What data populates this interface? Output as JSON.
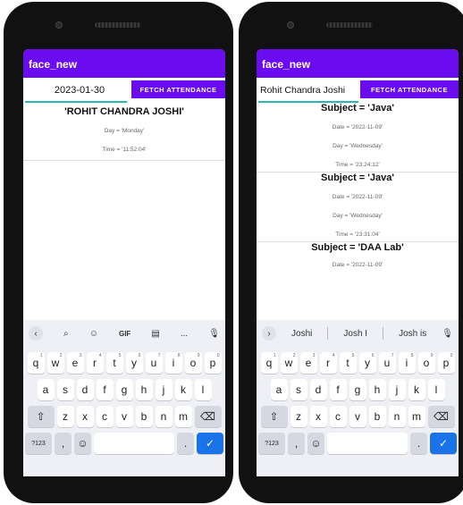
{
  "left": {
    "app_title": "face_new",
    "date_input_value": "2023-01-30",
    "fetch_label": "FETCH ATTENDANCE",
    "name_line": "'ROHIT CHANDRA JOSHI'",
    "day_line": "Day = 'Monday'",
    "time_line": "Time = '11:52:04'",
    "toolbar_gif": "GIF",
    "toolbar_more": "...",
    "key_123": "?123",
    "key_comma": ",",
    "key_period": "."
  },
  "right": {
    "app_title": "face_new",
    "name_input_value": "Rohit Chandra Joshi",
    "fetch_label": "FETCH ATTENDANCE",
    "records": [
      {
        "subject": "Subject = 'Java'",
        "date": "Date = '2022-11-09'",
        "day": "Day = 'Wednesday'",
        "time": "Time = '23:24:12'"
      },
      {
        "subject": "Subject = 'Java'",
        "date": "Date = '2022-11-09'",
        "day": "Day = 'Wednesday'",
        "time": "Time = '23:31:04'"
      },
      {
        "subject": "Subject = 'DAA Lab'",
        "date": "Date = '2022-11-09'"
      }
    ],
    "suggestions": [
      "Joshi",
      "Josh I",
      "Josh is"
    ],
    "key_123": "?123",
    "key_comma": ",",
    "key_period": "."
  },
  "keyboard": {
    "row1": [
      "q",
      "w",
      "e",
      "r",
      "t",
      "y",
      "u",
      "i",
      "o",
      "p"
    ],
    "row1_nums": [
      "1",
      "2",
      "3",
      "4",
      "5",
      "6",
      "7",
      "8",
      "9",
      "0"
    ],
    "row2": [
      "a",
      "s",
      "d",
      "f",
      "g",
      "h",
      "j",
      "k",
      "l"
    ],
    "row3": [
      "z",
      "x",
      "c",
      "v",
      "b",
      "n",
      "m"
    ]
  }
}
